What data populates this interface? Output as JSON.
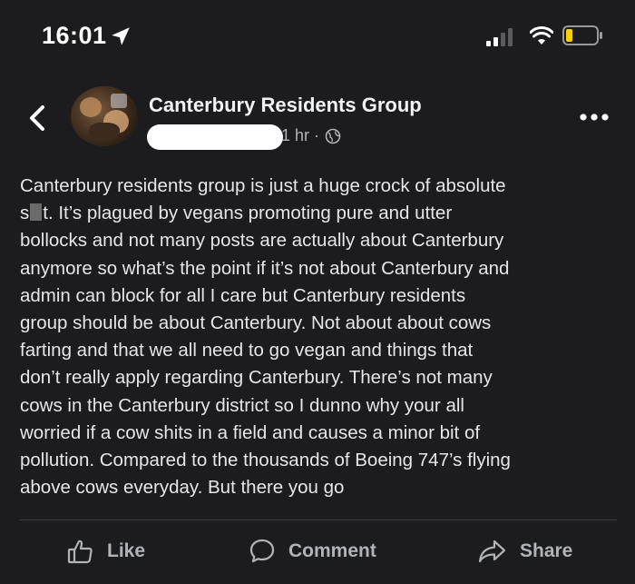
{
  "status_bar": {
    "time": "16:01",
    "icons": [
      "location-arrow-icon",
      "signal-icon",
      "wifi-icon",
      "battery-icon"
    ]
  },
  "header": {
    "back_icon": "chevron-left-icon",
    "group_name": "Canterbury Residents Group",
    "post_time": "1 hr ·",
    "privacy_icon": "globe-icon",
    "more_icon": "ellipsis-icon"
  },
  "post": {
    "lines": [
      "Canterbury residents group is just a huge crock of absolute",
      "t. It’s plagued by vegans promoting pure and utter",
      "bollocks and not many posts are actually about Canterbury",
      "anymore so what’s the point if it’s not about Canterbury and",
      "admin can block for all I care but Canterbury residents",
      "group should be about Canterbury. Not about about cows",
      "farting and that we all need to go vegan and things that",
      "don’t really apply regarding Canterbury. There’s not many",
      "cows in the Canterbury district so I dunno why your all",
      "worried if a cow shits in a field and causes a minor bit of",
      "pollution. Compared to the thousands of Boeing 747’s flying",
      "above cows everyday. But there you go"
    ],
    "line2_prefix": "s"
  },
  "actions": {
    "like": "Like",
    "comment": "Comment",
    "share": "Share"
  },
  "colors": {
    "background": "#1c1c1e",
    "text": "#e4e6eb",
    "secondary_text": "#b0b3b8"
  }
}
